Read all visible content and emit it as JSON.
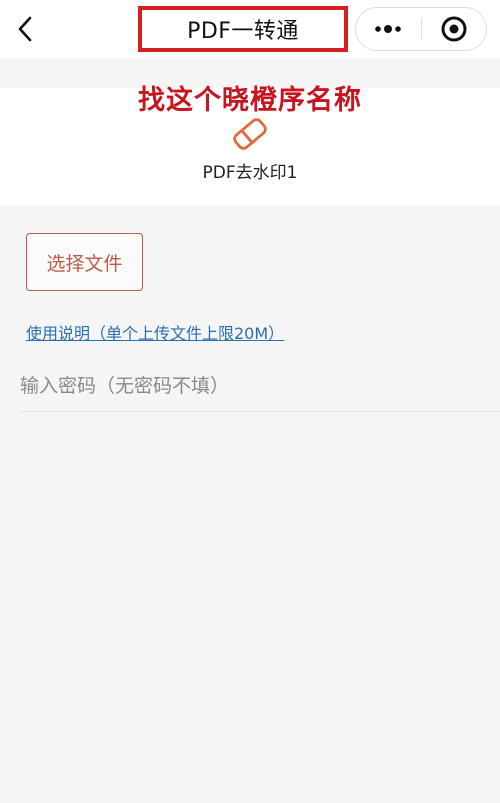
{
  "nav": {
    "back_icon": "chevron-left-icon",
    "title": "PDF一转通",
    "title_highlight_color": "#d32020",
    "more_icon": "more-dots-icon",
    "close_icon": "target-circle-icon"
  },
  "annotation": {
    "text": "找这个晓橙序名称",
    "color": "#c8141e"
  },
  "tool": {
    "icon": "eraser-icon",
    "name": "PDF去水印1",
    "accent_color": "#e06a3c"
  },
  "actions": {
    "choose_file_label": "选择文件",
    "usage_link_text": "使用说明（单个上传文件上限20M）"
  },
  "password": {
    "value": "",
    "placeholder": "输入密码（无密码不填）"
  }
}
